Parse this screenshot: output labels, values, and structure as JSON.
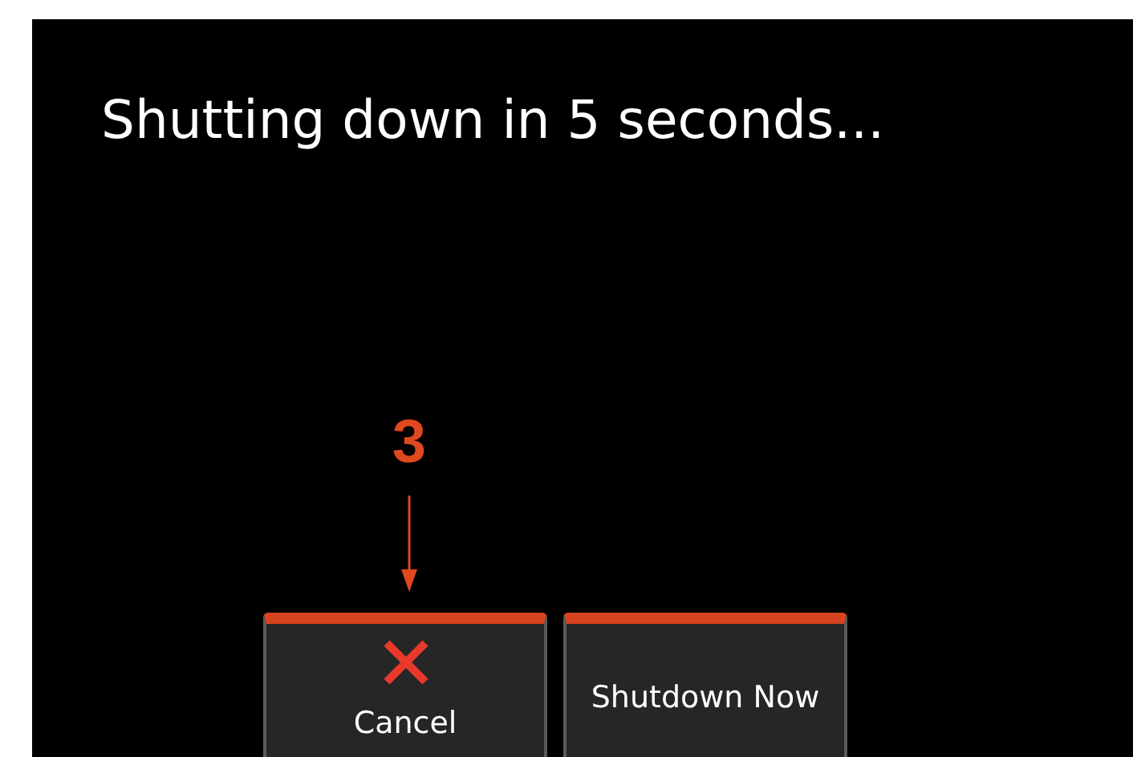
{
  "title": "Shutting down in 5 seconds...",
  "callout": {
    "label": "3"
  },
  "buttons": [
    {
      "kind": "icon",
      "label": "Cancel"
    },
    {
      "kind": "text",
      "label": "Shutdown Now"
    }
  ]
}
